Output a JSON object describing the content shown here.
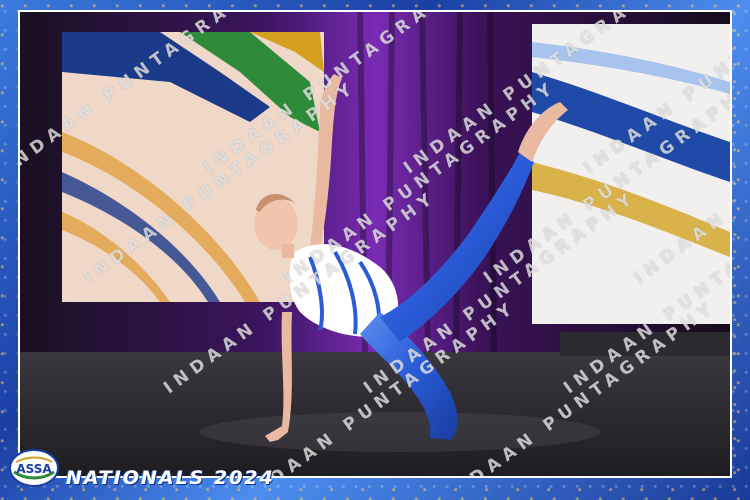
{
  "event": {
    "title": "NATIONALS 2024",
    "logo_text": "ASSA"
  },
  "watermark": {
    "text": "INDAAN PUNTAGRAPHY"
  },
  "colors": {
    "frame_blue": "#1f4fb8",
    "costume_blue": "#2a5bd8",
    "curtain_purple": "#5a1f8c",
    "stage_floor": "#2b2a2f"
  },
  "icons": {
    "logo": "assa-globe-logo"
  }
}
